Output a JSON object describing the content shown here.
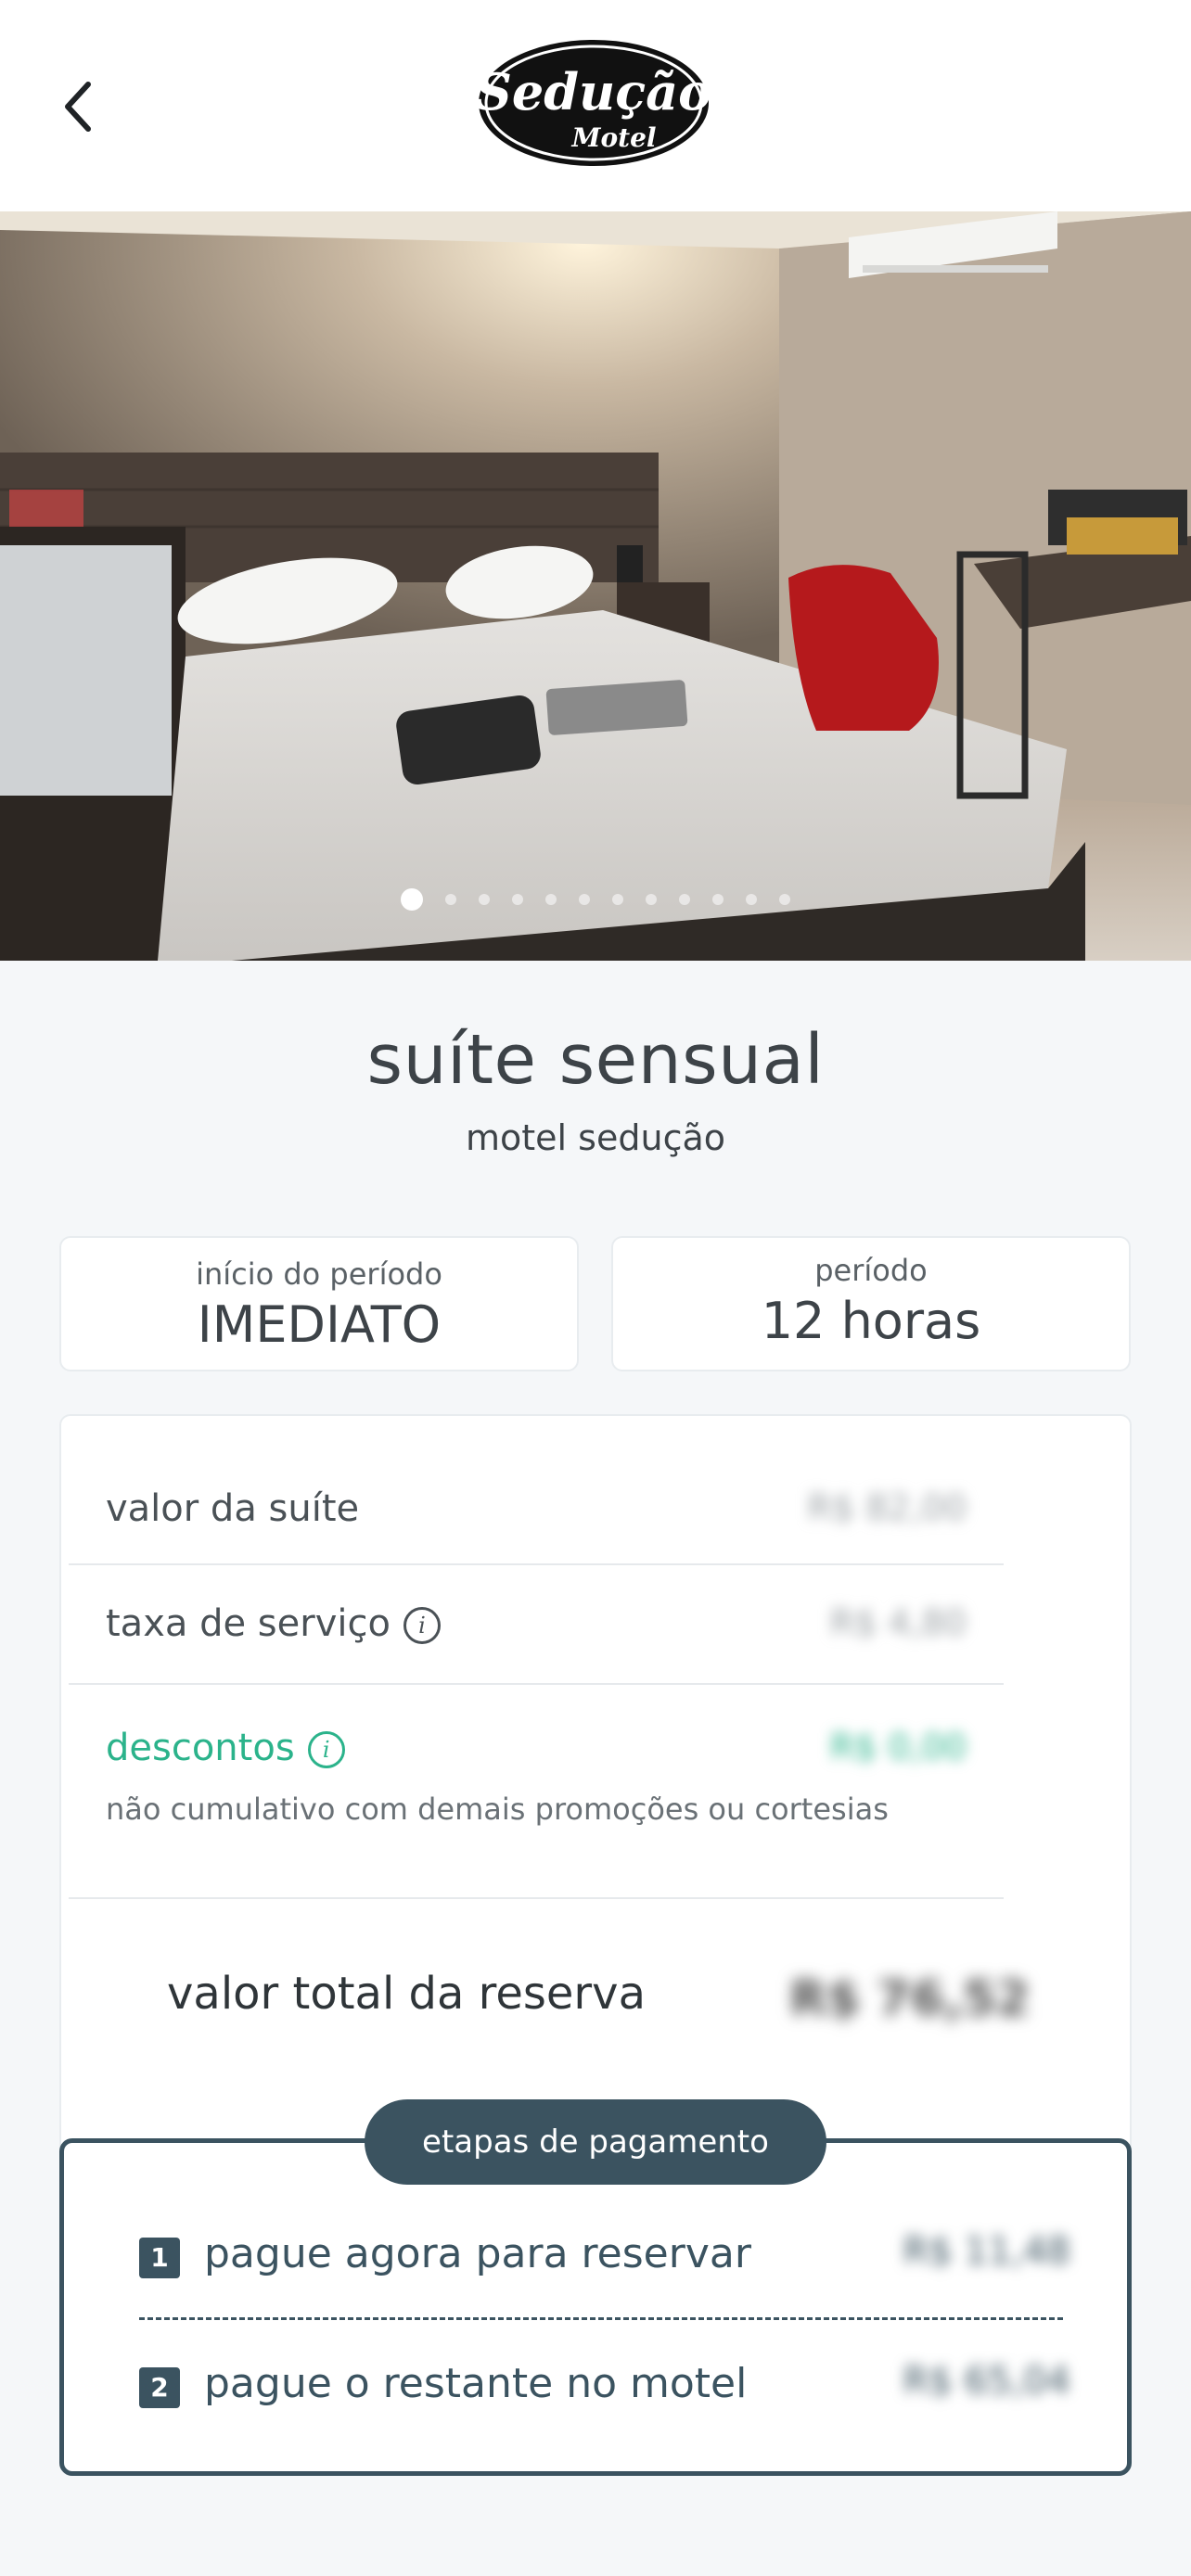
{
  "header": {
    "brand_name": "Sedução",
    "brand_sub": "Motel"
  },
  "gallery": {
    "image_count": 12,
    "active_index": 0
  },
  "suite": {
    "title": "suíte sensual",
    "motel_name": "motel sedução"
  },
  "booking": {
    "start_label": "início do período",
    "start_value": "IMEDIATO",
    "period_label": "período",
    "period_value": "12 horas"
  },
  "pricing": {
    "suite_value_label": "valor da suíte",
    "suite_value": "R$ 82,00",
    "service_fee_label": "taxa de serviço",
    "service_fee": "R$ 4,80",
    "discounts_label": "descontos",
    "discounts_value": "R$ 0,00",
    "discounts_note": "não cumulativo com demais promoções ou cortesias",
    "total_label": "valor total da reserva",
    "total_value": "R$ 76,52"
  },
  "payment_steps": {
    "title": "etapas de pagamento",
    "steps": [
      {
        "number": "1",
        "label": "pague agora para reservar",
        "amount": "R$ 11,48"
      },
      {
        "number": "2",
        "label": "pague o restante no motel",
        "amount": "R$ 65,04"
      }
    ]
  },
  "colors": {
    "accent_dark": "#3b5360",
    "discount_green": "#2bb38b"
  }
}
